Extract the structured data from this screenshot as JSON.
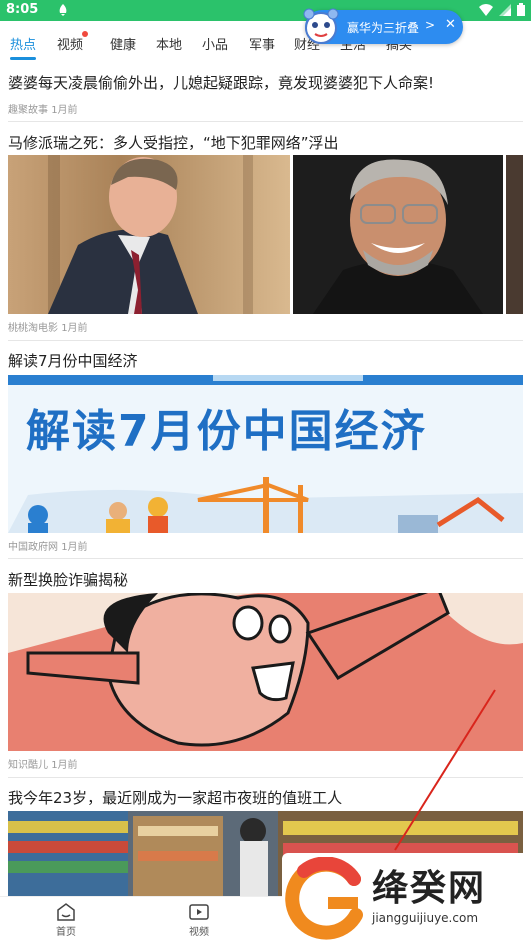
{
  "status_bar": {
    "time": "8:05",
    "bg_color": "#2bc26b"
  },
  "tabs": [
    {
      "label": "热点",
      "active": true
    },
    {
      "label": "视频",
      "has_dot": true
    },
    {
      "label": "健康"
    },
    {
      "label": "本地"
    },
    {
      "label": "小品"
    },
    {
      "label": "军事"
    },
    {
      "label": "财经"
    },
    {
      "label": "生活"
    },
    {
      "label": "搞笑"
    }
  ],
  "banner": {
    "text": "赢华为三折叠",
    "chevron": ">",
    "close": "✕"
  },
  "feed": [
    {
      "title": "婆婆每天凌晨偷偷外出，儿媳起疑跟踪，竟发现婆婆犯下人命案!",
      "source": "趣聚故事",
      "time": "1月前"
    },
    {
      "title": "马修派瑞之死：多人受指控，“地下犯罪网络”浮出",
      "source": "桃桃淘电影",
      "time": "1月前"
    },
    {
      "title": "解读7月份中国经济",
      "source": "中国政府网",
      "time": "1月前",
      "image_text": "解读7月份中国经济"
    },
    {
      "title": "新型换脸诈骗揭秘",
      "source": "知识酷儿",
      "time": "1月前"
    },
    {
      "title": "我今年23岁，最近刚成为一家超市夜班的值班工人"
    }
  ],
  "bottom_nav": [
    {
      "label": "首页",
      "icon": "home-icon"
    },
    {
      "label": "视频",
      "icon": "video-icon"
    }
  ],
  "watermark": {
    "text": "绛癸网",
    "url": "jiangguijiuye.com"
  },
  "accent_color": "#1a8fdc"
}
